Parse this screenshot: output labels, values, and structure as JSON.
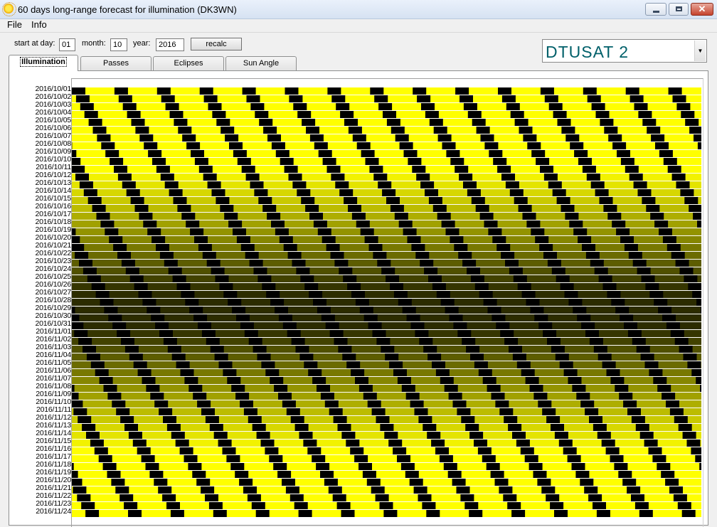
{
  "window": {
    "title": "60 days long-range forecast for illumination (DK3WN)",
    "app_icon": "sun-icon",
    "controls": {
      "minimize": "minimize-icon",
      "maximize": "maximize-icon",
      "close": "close-icon"
    }
  },
  "menu": {
    "file": "File",
    "info": "Info"
  },
  "controls": {
    "day_label": "start at day:",
    "day_value": "01",
    "month_label": "month:",
    "month_value": "10",
    "year_label": "year:",
    "year_value": "2016",
    "recalc_label": "recalc"
  },
  "satellite": {
    "selected": "DTUSAT 2",
    "dropdown_icon": "chevron-down-icon"
  },
  "tabs": [
    {
      "label": "Illumination",
      "active": true
    },
    {
      "label": "Passes",
      "active": false
    },
    {
      "label": "Eclipses",
      "active": false
    },
    {
      "label": "Sun Angle",
      "active": false
    }
  ],
  "illumination": {
    "dates": [
      "2016/10/01",
      "2016/10/02",
      "2016/10/03",
      "2016/10/04",
      "2016/10/05",
      "2016/10/06",
      "2016/10/07",
      "2016/10/08",
      "2016/10/09",
      "2016/10/10",
      "2016/10/11",
      "2016/10/12",
      "2016/10/13",
      "2016/10/14",
      "2016/10/15",
      "2016/10/16",
      "2016/10/17",
      "2016/10/18",
      "2016/10/19",
      "2016/10/20",
      "2016/10/21",
      "2016/10/22",
      "2016/10/23",
      "2016/10/24",
      "2016/10/25",
      "2016/10/26",
      "2016/10/27",
      "2016/10/28",
      "2016/10/29",
      "2016/10/30",
      "2016/10/31",
      "2016/11/01",
      "2016/11/02",
      "2016/11/03",
      "2016/11/04",
      "2016/11/05",
      "2016/11/06",
      "2016/11/07",
      "2016/11/08",
      "2016/11/09",
      "2016/11/10",
      "2016/11/11",
      "2016/11/12",
      "2016/11/13",
      "2016/11/14",
      "2016/11/15",
      "2016/11/16",
      "2016/11/17",
      "2016/11/18",
      "2016/11/19",
      "2016/11/20",
      "2016/11/21",
      "2016/11/22",
      "2016/11/23",
      "2016/11/24"
    ],
    "colors": {
      "shadow": "#000000",
      "full_sun": "#ffff00",
      "dim_sun": "#808000",
      "separator": "#ffffff"
    }
  }
}
